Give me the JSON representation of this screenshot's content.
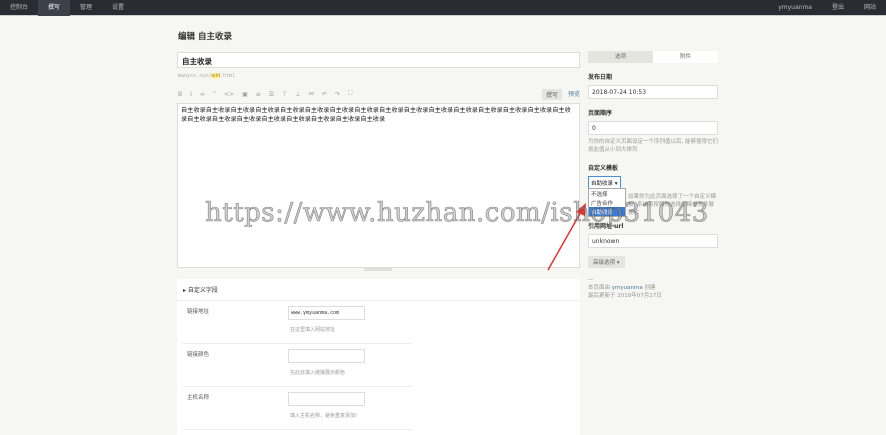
{
  "nav": {
    "items": [
      "控制台",
      "撰写",
      "管理",
      "设置"
    ],
    "active": 1,
    "user": "ymyuanma",
    "logout": "登出",
    "site": "网站"
  },
  "page_title": "编辑 自主收录",
  "post": {
    "title": "自主收录",
    "slug_prefix": "manycs.xyz/",
    "slug": "add",
    "slug_suffix": ".html",
    "content": "自主收录自主收录自主收录自主收录自主收录自主收录自主收录自主收录自主收录自主收录自主收录自主收录自主收录自主收录自主收录自主收录自主收录自主收录自主收录自主收录自主收录自主收录自主收录自主收录"
  },
  "toolbar": {
    "icons": [
      "B",
      "I",
      "∞",
      "“",
      "<>",
      "▣",
      "≡",
      "☰",
      "⊤",
      "⊥",
      "⫘",
      "↶",
      "↷",
      "⛶"
    ],
    "write": "撰写",
    "preview": "预览"
  },
  "custom_fields": {
    "header": "自定义字段",
    "rows": [
      {
        "label": "链接地址",
        "value": "www.ymyuanma.com",
        "desc": "在这里填入网站地址"
      },
      {
        "label": "链接颜色",
        "value": "",
        "desc": "在此处填入链接展示颜色"
      },
      {
        "label": "主机名称",
        "value": "",
        "desc": "填入主机名称，避免重复添加!"
      }
    ]
  },
  "sidebar": {
    "tabs": [
      "选项",
      "附件"
    ],
    "date_label": "发布日期",
    "date": "2018-07-24 10:53",
    "order_label": "页面顺序",
    "order": "0",
    "order_desc": "为你的自定义页面设定一个序列值以后, 能够使得它们按此值从小到大排列",
    "template_label": "自定义模板",
    "template_value": "自助收录 ▾",
    "template_options": [
      "不选择",
      "广告合作",
      "自助收录"
    ],
    "template_desc": "如果你为此页面选择了一个自定义模板, 系统将按照你选择的模板文件展现它",
    "ref_label": "引用网址 url",
    "ref_value": "unknown",
    "advanced": "高级选项 ▾",
    "created_prefix": "本页面由",
    "created_user": "ymyuanma",
    "created_suffix": "创建",
    "modified": "最后更新于 2018年07月27日"
  },
  "watermark": "https://www.huzhan.com/ishop31043",
  "colors": {
    "topbar": "#292d33",
    "accent": "#467b96",
    "selected": "#3a7bd5",
    "arrow": "#e8322e"
  }
}
